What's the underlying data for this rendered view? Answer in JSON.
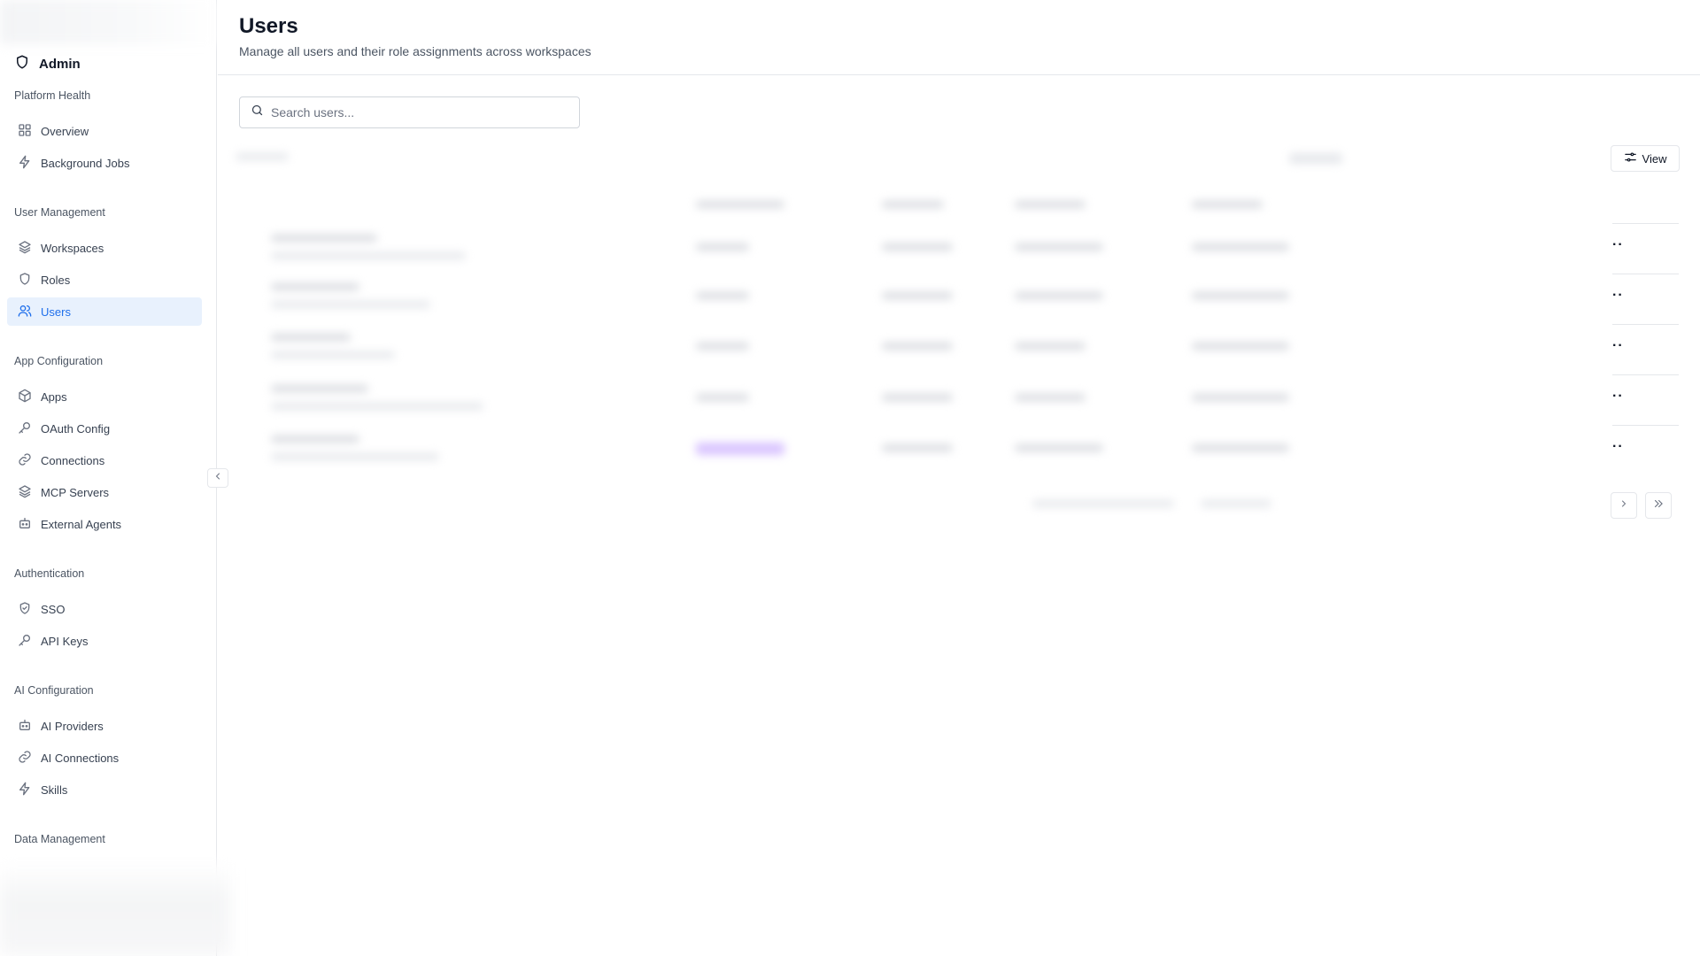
{
  "sidebar": {
    "brand": "Admin",
    "sections": [
      {
        "label": "Platform Health",
        "items": [
          {
            "label": "Overview",
            "icon": "grid-icon"
          },
          {
            "label": "Background Jobs",
            "icon": "bolt-icon"
          }
        ]
      },
      {
        "label": "User Management",
        "items": [
          {
            "label": "Workspaces",
            "icon": "layers-icon"
          },
          {
            "label": "Roles",
            "icon": "shield-icon"
          },
          {
            "label": "Users",
            "icon": "users-icon",
            "active": true
          }
        ]
      },
      {
        "label": "App Configuration",
        "items": [
          {
            "label": "Apps",
            "icon": "box-icon"
          },
          {
            "label": "OAuth Config",
            "icon": "key-icon"
          },
          {
            "label": "Connections",
            "icon": "link-icon"
          },
          {
            "label": "MCP Servers",
            "icon": "layers-icon"
          },
          {
            "label": "External Agents",
            "icon": "bot-icon"
          }
        ]
      },
      {
        "label": "Authentication",
        "items": [
          {
            "label": "SSO",
            "icon": "shield-check-icon"
          },
          {
            "label": "API Keys",
            "icon": "key-icon"
          }
        ]
      },
      {
        "label": "AI Configuration",
        "items": [
          {
            "label": "AI Providers",
            "icon": "bot-icon"
          },
          {
            "label": "AI Connections",
            "icon": "link-icon"
          },
          {
            "label": "Skills",
            "icon": "bolt-icon"
          }
        ]
      },
      {
        "label": "Data Management",
        "items": []
      }
    ]
  },
  "header": {
    "title": "Users",
    "subtitle": "Manage all users and their role assignments across workspaces"
  },
  "search": {
    "placeholder": "Search users...",
    "value": ""
  },
  "toolbar": {
    "view_label": "View"
  },
  "table": {
    "row_actions": [
      "··",
      "··",
      "··",
      "··",
      "··"
    ]
  },
  "colors": {
    "accent": "#1f6feb",
    "active_bg": "#e8f1fd",
    "border": "#e5e7eb"
  }
}
